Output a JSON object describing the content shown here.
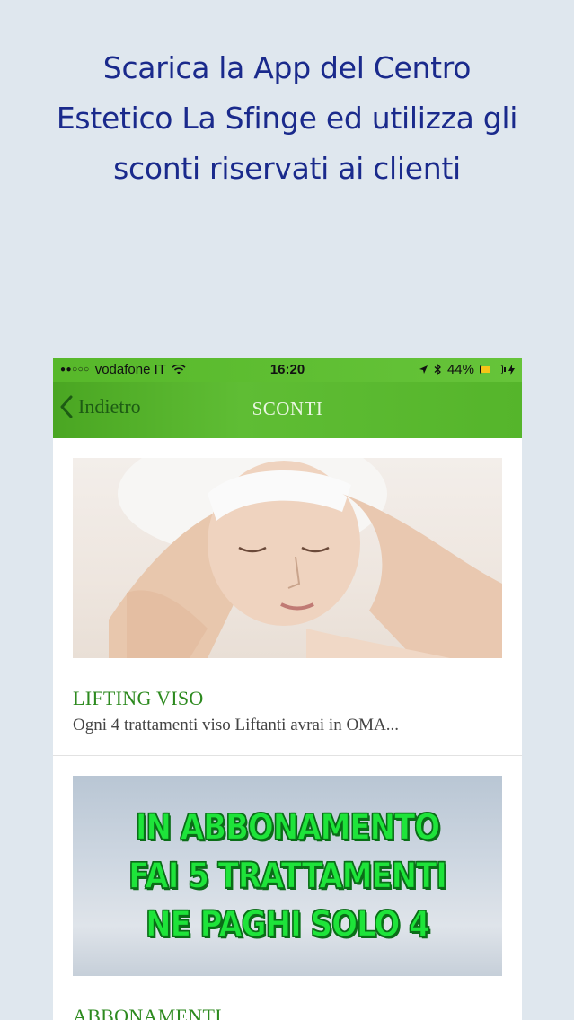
{
  "promo": {
    "line1": "Scarica la App del Centro",
    "line2": "Estetico La Sfinge ed utilizza gli",
    "line3": "sconti riservati ai clienti"
  },
  "status_bar": {
    "carrier": "vodafone IT",
    "time": "16:20",
    "battery": "44%",
    "battery_level": 0.44
  },
  "navbar": {
    "back_label": "Indietro",
    "title": "SCONTI"
  },
  "cards": [
    {
      "image": "facial-massage-photo",
      "title": "LIFTING VISO",
      "description": "Ogni 4 trattamenti viso Liftanti avrai in OMA..."
    },
    {
      "image": "subscription-promo-banner",
      "banner_lines": [
        "IN ABBONAMENTO",
        "FAI 5 TRATTAMENTI",
        "NE PAGHI SOLO 4"
      ],
      "title": "ABBONAMENTI"
    }
  ],
  "colors": {
    "background": "#dfe7ee",
    "promo_text": "#1a2a8c",
    "nav_green": "#57b82a",
    "card_title": "#2d8a1f",
    "banner_text": "#1ee43a"
  }
}
